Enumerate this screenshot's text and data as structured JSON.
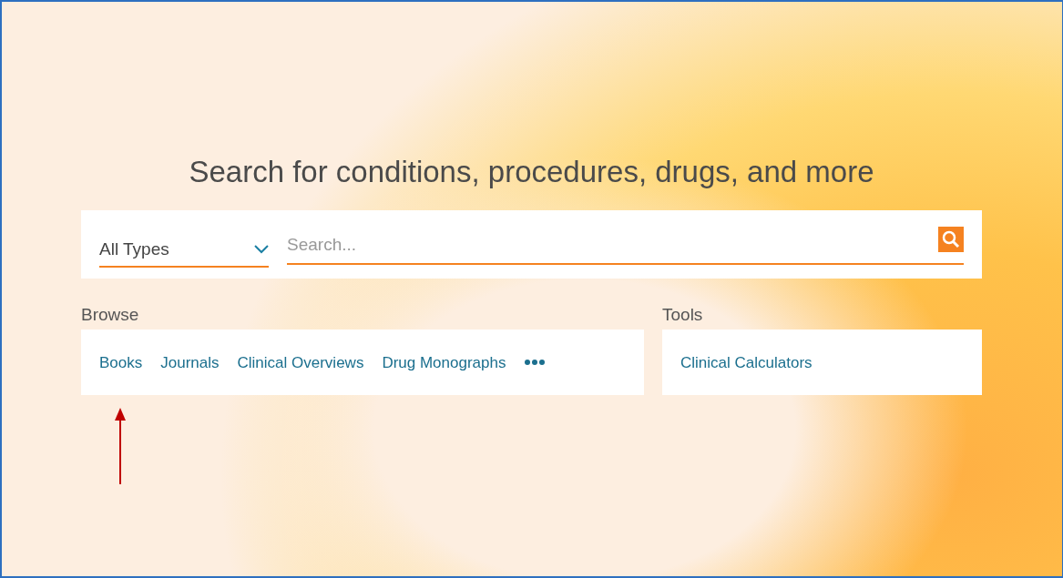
{
  "heading": "Search for conditions, procedures, drugs, and more",
  "search": {
    "type_select": "All Types",
    "placeholder": "Search..."
  },
  "browse": {
    "title": "Browse",
    "links": [
      "Books",
      "Journals",
      "Clinical Overviews",
      "Drug Monographs"
    ]
  },
  "tools": {
    "title": "Tools",
    "links": [
      "Clinical Calculators"
    ]
  }
}
